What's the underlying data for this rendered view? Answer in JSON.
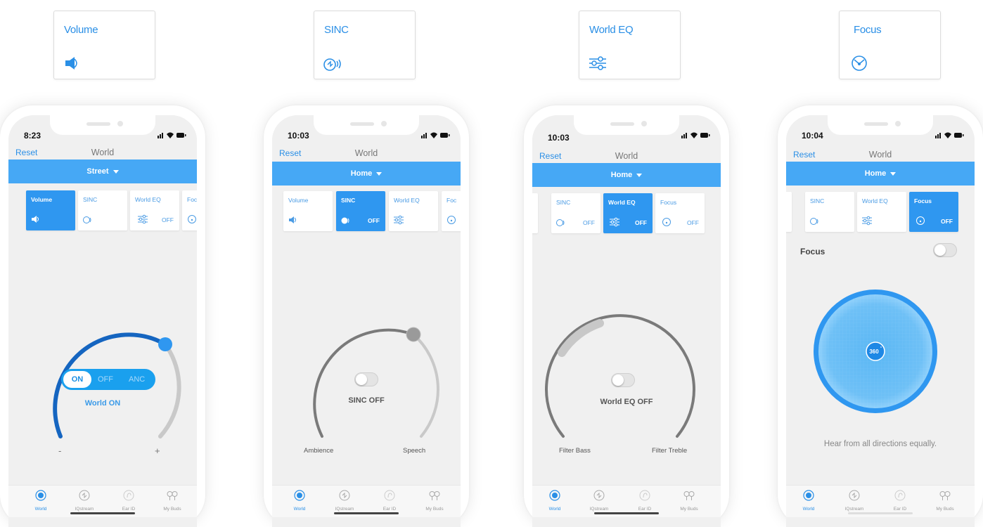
{
  "legend": [
    {
      "label": "Volume",
      "icon": "speaker-icon"
    },
    {
      "label": "SINC",
      "icon": "sinc-icon"
    },
    {
      "label": "World EQ",
      "icon": "sliders-icon"
    },
    {
      "label": "Focus",
      "icon": "focus-icon"
    }
  ],
  "colors": {
    "accent": "#2a8fe6",
    "bar": "#46a8f5",
    "active_tile": "#2f97f0",
    "dial_blue": "#1565c0"
  },
  "phones": [
    {
      "time": "8:23",
      "reset": "Reset",
      "title": "World",
      "environment": "Street",
      "tiles": [
        {
          "label": "Volume",
          "off": "",
          "active": true
        },
        {
          "label": "SINC",
          "off": "",
          "active": false
        },
        {
          "label": "World EQ",
          "off": "OFF",
          "active": false
        },
        {
          "label": "Foc",
          "off": "",
          "active": false
        }
      ],
      "segment": {
        "on": "ON",
        "off": "OFF",
        "anc": "ANC"
      },
      "caption": "World ON",
      "minus": "-",
      "plus": "+"
    },
    {
      "time": "10:03",
      "reset": "Reset",
      "title": "World",
      "environment": "Home",
      "tiles": [
        {
          "label": "Volume",
          "off": "",
          "active": false
        },
        {
          "label": "SINC",
          "off": "OFF",
          "active": true
        },
        {
          "label": "World EQ",
          "off": "",
          "active": false
        },
        {
          "label": "Foc",
          "off": "",
          "active": false
        }
      ],
      "caption": "SINC OFF",
      "left_label": "Ambience",
      "right_label": "Speech"
    },
    {
      "time": "10:03",
      "reset": "Reset",
      "title": "World",
      "environment": "Home",
      "tiles": [
        {
          "label": "SINC",
          "off": "OFF",
          "active": false
        },
        {
          "label": "World EQ",
          "off": "OFF",
          "active": true
        },
        {
          "label": "Focus",
          "off": "OFF",
          "active": false
        }
      ],
      "caption": "World EQ OFF",
      "left_label": "Filter Bass",
      "right_label": "Filter Treble"
    },
    {
      "time": "10:04",
      "reset": "Reset",
      "title": "World",
      "environment": "Home",
      "tiles": [
        {
          "label": "SINC",
          "off": "",
          "active": false
        },
        {
          "label": "World EQ",
          "off": "",
          "active": false
        },
        {
          "label": "Focus",
          "off": "OFF",
          "active": true
        }
      ],
      "focus_label": "Focus",
      "focus_value": "360",
      "focus_degree": "°",
      "focus_caption": "Hear from all directions equally."
    }
  ],
  "tabs": [
    {
      "label": "World"
    },
    {
      "label": "IQstream"
    },
    {
      "label": "Ear ID"
    },
    {
      "label": "My Buds"
    }
  ]
}
